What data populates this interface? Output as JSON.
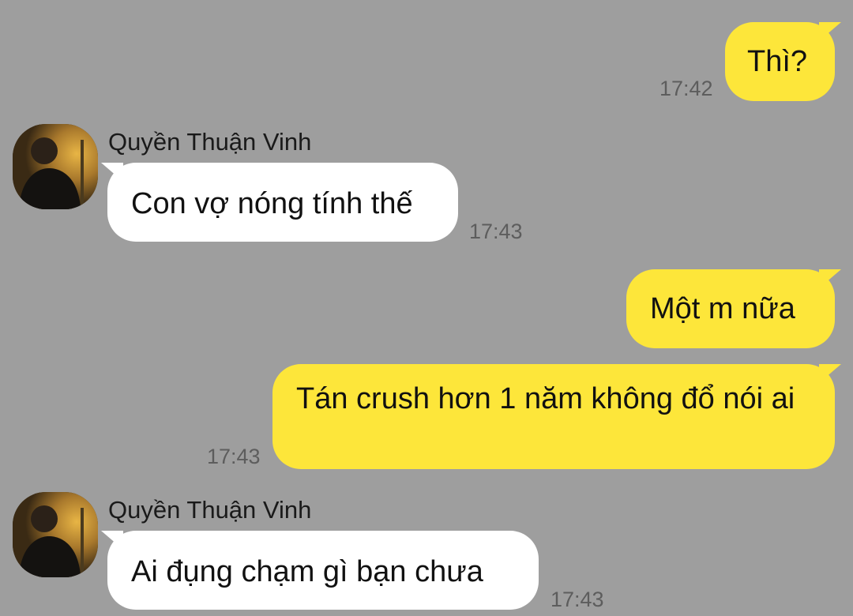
{
  "messages": [
    {
      "direction": "out",
      "text": "Thì?",
      "time": "17:42"
    },
    {
      "direction": "in",
      "sender": "Quyền Thuận Vinh",
      "text": "Con vợ nóng tính thế",
      "time": "17:43"
    },
    {
      "direction": "out",
      "text": "Một m nữa"
    },
    {
      "direction": "out",
      "text": "Tán crush hơn 1 năm không đổ nói ai",
      "time": "17:43"
    },
    {
      "direction": "in",
      "sender": "Quyền Thuận Vinh",
      "text": "Ai đụng chạm gì bạn chưa",
      "time": "17:43"
    }
  ],
  "colors": {
    "background": "#9e9e9e",
    "outgoing_bubble": "#fde63a",
    "incoming_bubble": "#ffffff",
    "timestamp": "#5d5d5d"
  },
  "icons": {
    "avatar": "contact-avatar-photo"
  }
}
